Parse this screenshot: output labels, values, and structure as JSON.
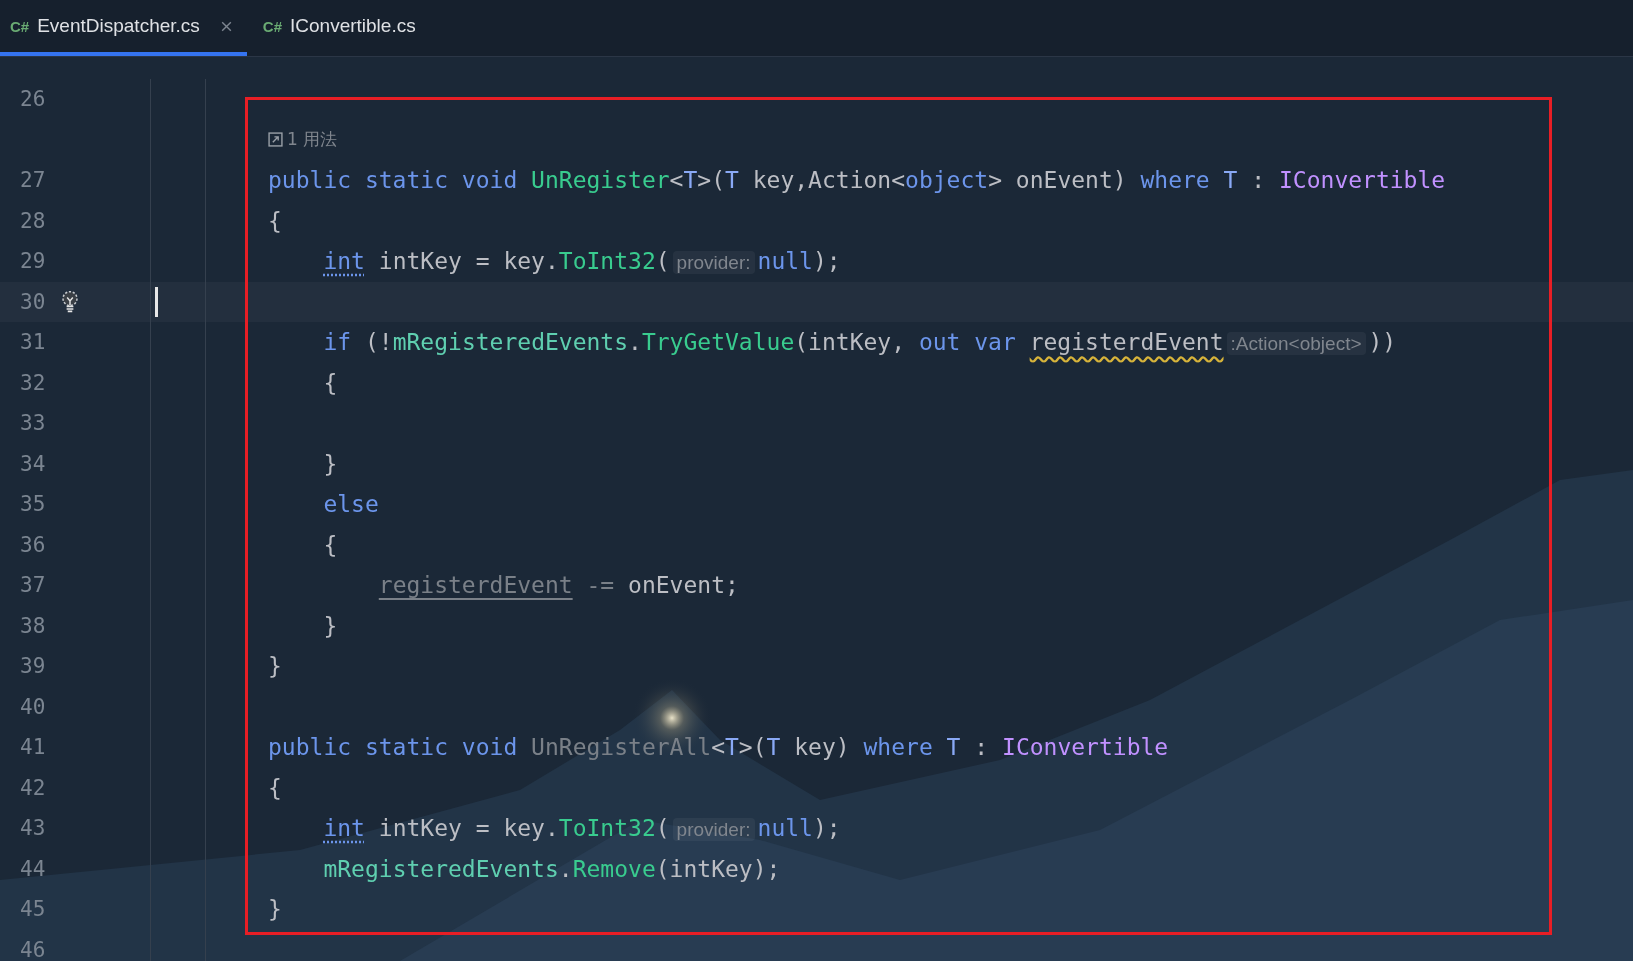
{
  "tabs": [
    {
      "lang": "C#",
      "label": "EventDispatcher.cs",
      "selected": true
    },
    {
      "lang": "C#",
      "label": "IConvertible.cs",
      "selected": false
    }
  ],
  "lines": [
    {
      "kind": "code",
      "number": "26",
      "current": false
    },
    {
      "kind": "usage",
      "text": "1 用法",
      "current": false
    },
    {
      "kind": "code",
      "number": "27",
      "current": false,
      "tokens": [
        {
          "t": "public static void ",
          "kind": "kw"
        },
        {
          "t": "UnRegister",
          "kind": "fn"
        },
        {
          "t": "<",
          "kind": "p"
        },
        {
          "t": "T",
          "kind": "tp"
        },
        {
          "t": ">(",
          "kind": "p"
        },
        {
          "t": "T",
          "kind": "tp"
        },
        {
          "t": " key,Action<",
          "kind": "p"
        },
        {
          "t": "object",
          "kind": "kw"
        },
        {
          "t": "> onEvent) ",
          "kind": "p"
        },
        {
          "t": "where ",
          "kind": "kw"
        },
        {
          "t": "T",
          "kind": "tp"
        },
        {
          "t": " : ",
          "kind": "p"
        },
        {
          "t": "IConvertible",
          "kind": "iface"
        }
      ]
    },
    {
      "kind": "code",
      "number": "28",
      "current": false,
      "tokens": [
        {
          "t": "{",
          "kind": "p"
        }
      ]
    },
    {
      "kind": "code",
      "number": "29",
      "current": false,
      "tokens": [
        {
          "t": "    int",
          "kind": "kwdot"
        },
        {
          "t": " intKey = key.",
          "kind": "p"
        },
        {
          "t": "ToInt32",
          "kind": "fn"
        },
        {
          "t": "(",
          "kind": "p"
        },
        {
          "t": "provider:",
          "kind": "hint"
        },
        {
          "t": "null",
          "kind": "kw"
        },
        {
          "t": ");",
          "kind": "p"
        }
      ]
    },
    {
      "kind": "code",
      "number": "30",
      "current": true,
      "bulb": true
    },
    {
      "kind": "code",
      "number": "31",
      "current": false,
      "tokens": [
        {
          "t": "    if",
          "kind": "kw"
        },
        {
          "t": " (!",
          "kind": "p"
        },
        {
          "t": "mRegisteredEvents",
          "kind": "field"
        },
        {
          "t": ".",
          "kind": "p"
        },
        {
          "t": "TryGetValue",
          "kind": "fn"
        },
        {
          "t": "(intKey, ",
          "kind": "p"
        },
        {
          "t": "out var ",
          "kind": "kw"
        },
        {
          "t": "registerdEvent",
          "kind": "warn"
        },
        {
          "t": ":Action<object>",
          "kind": "hint"
        },
        {
          "t": "))",
          "kind": "p"
        }
      ]
    },
    {
      "kind": "code",
      "number": "32",
      "current": false,
      "tokens": [
        {
          "t": "    {",
          "kind": "p"
        }
      ]
    },
    {
      "kind": "code",
      "number": "33",
      "current": false
    },
    {
      "kind": "code",
      "number": "34",
      "current": false,
      "tokens": [
        {
          "t": "    }",
          "kind": "p"
        }
      ]
    },
    {
      "kind": "code",
      "number": "35",
      "current": false,
      "tokens": [
        {
          "t": "    else",
          "kind": "kw"
        }
      ]
    },
    {
      "kind": "code",
      "number": "36",
      "current": false,
      "tokens": [
        {
          "t": "    {",
          "kind": "p"
        }
      ]
    },
    {
      "kind": "code",
      "number": "37",
      "current": false,
      "tokens": [
        {
          "t": "        registerdEvent",
          "kind": "unusedline"
        },
        {
          "t": " -=",
          "kind": "unused"
        },
        {
          "t": " onEvent;",
          "kind": "p"
        }
      ]
    },
    {
      "kind": "code",
      "number": "38",
      "current": false,
      "tokens": [
        {
          "t": "    }",
          "kind": "p"
        }
      ]
    },
    {
      "kind": "code",
      "number": "39",
      "current": false,
      "tokens": [
        {
          "t": "}",
          "kind": "p"
        }
      ]
    },
    {
      "kind": "code",
      "number": "40",
      "current": false
    },
    {
      "kind": "code",
      "number": "41",
      "current": false,
      "tokens": [
        {
          "t": "public static void ",
          "kind": "kw"
        },
        {
          "t": "UnRegisterAll",
          "kind": "unused"
        },
        {
          "t": "<",
          "kind": "p"
        },
        {
          "t": "T",
          "kind": "tp"
        },
        {
          "t": ">(",
          "kind": "p"
        },
        {
          "t": "T",
          "kind": "tp"
        },
        {
          "t": " key) ",
          "kind": "p"
        },
        {
          "t": "where ",
          "kind": "kw"
        },
        {
          "t": "T",
          "kind": "tp"
        },
        {
          "t": " : ",
          "kind": "p"
        },
        {
          "t": "IConvertible",
          "kind": "iface"
        }
      ]
    },
    {
      "kind": "code",
      "number": "42",
      "current": false,
      "tokens": [
        {
          "t": "{",
          "kind": "p"
        }
      ]
    },
    {
      "kind": "code",
      "number": "43",
      "current": false,
      "tokens": [
        {
          "t": "    int",
          "kind": "kwdot"
        },
        {
          "t": " intKey = key.",
          "kind": "p"
        },
        {
          "t": "ToInt32",
          "kind": "fn"
        },
        {
          "t": "(",
          "kind": "p"
        },
        {
          "t": "provider:",
          "kind": "hint"
        },
        {
          "t": "null",
          "kind": "kw"
        },
        {
          "t": ");",
          "kind": "p"
        }
      ]
    },
    {
      "kind": "code",
      "number": "44",
      "current": false,
      "tokens": [
        {
          "t": "    mRegisteredEvents",
          "kind": "field"
        },
        {
          "t": ".",
          "kind": "p"
        },
        {
          "t": "Remove",
          "kind": "fn"
        },
        {
          "t": "(intKey);",
          "kind": "p"
        }
      ]
    },
    {
      "kind": "code",
      "number": "45",
      "current": false,
      "tokens": [
        {
          "t": "}",
          "kind": "p"
        }
      ]
    },
    {
      "kind": "code",
      "number": "46",
      "current": false
    }
  ]
}
